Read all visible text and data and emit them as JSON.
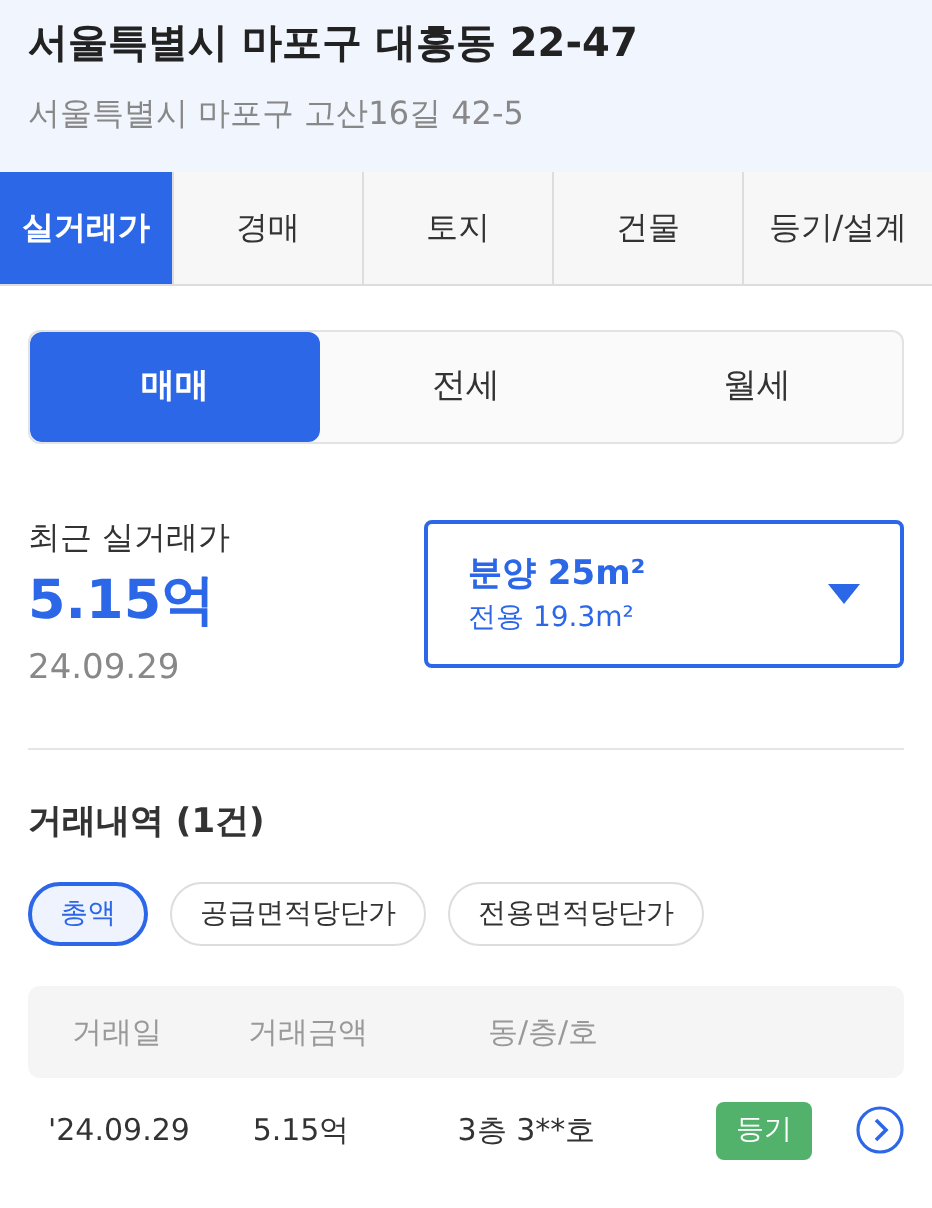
{
  "header": {
    "title": "서울특별시 마포구 대흥동 22-47",
    "subtitle": "서울특별시 마포구 고산16길 42-5"
  },
  "tabs": [
    {
      "label": "실거래가",
      "selected": true
    },
    {
      "label": "경매",
      "selected": false
    },
    {
      "label": "토지",
      "selected": false
    },
    {
      "label": "건물",
      "selected": false
    },
    {
      "label": "등기/설계",
      "selected": false
    }
  ],
  "deal_types": [
    {
      "label": "매매",
      "selected": true
    },
    {
      "label": "전세",
      "selected": false
    },
    {
      "label": "월세",
      "selected": false
    }
  ],
  "recent": {
    "label": "최근 실거래가",
    "price": "5.15억",
    "date": "24.09.29"
  },
  "area_select": {
    "main": "분양 25m²",
    "sub": "전용 19.3m²"
  },
  "history": {
    "title": "거래내역 (1건)",
    "filters": [
      {
        "label": "총액",
        "selected": true
      },
      {
        "label": "공급면적당단가",
        "selected": false
      },
      {
        "label": "전용면적당단가",
        "selected": false
      }
    ],
    "columns": [
      "거래일",
      "거래금액",
      "동/층/호"
    ],
    "rows": [
      {
        "date": "'24.09.29",
        "price": "5.15억",
        "unit": "3층 3**호",
        "badge": "등기"
      }
    ]
  }
}
